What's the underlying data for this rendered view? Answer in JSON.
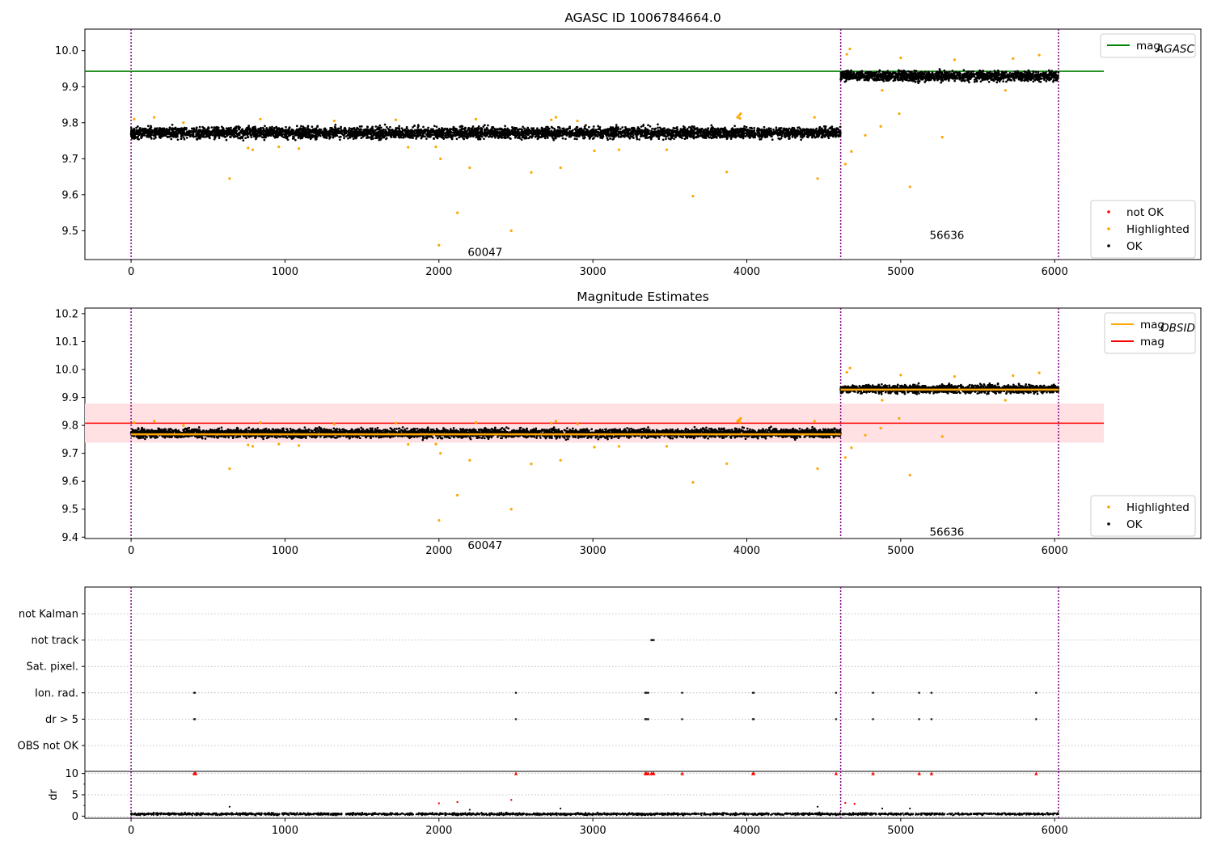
{
  "chart_data": [
    {
      "type": "scatter",
      "title": "AGASC ID 1006784664.0",
      "xlim": [
        -300,
        6950
      ],
      "ylim": [
        9.42,
        10.06
      ],
      "xticks": [
        0,
        1000,
        2000,
        3000,
        4000,
        5000,
        6000
      ],
      "yticks": [
        9.5,
        9.6,
        9.7,
        9.8,
        9.9,
        10.0
      ],
      "obs_boundaries": [
        0,
        4610,
        6025
      ],
      "segments": [
        {
          "label": "60047",
          "x_range": [
            0,
            4610
          ],
          "mean": 9.772,
          "spread": 0.02
        },
        {
          "label": "56636",
          "x_range": [
            4610,
            6025
          ],
          "mean": 9.93,
          "spread": 0.018
        }
      ],
      "hlines": [
        {
          "name": "mag_AGASC",
          "y": 9.943,
          "x_range": [
            -300,
            6320
          ],
          "color": "#008000"
        }
      ],
      "highlighted_points": [
        [
          640,
          9.645
        ],
        [
          760,
          9.73
        ],
        [
          790,
          9.725
        ],
        [
          960,
          9.733
        ],
        [
          1090,
          9.728
        ],
        [
          1800,
          9.732
        ],
        [
          1980,
          9.733
        ],
        [
          2000,
          9.46
        ],
        [
          2010,
          9.7
        ],
        [
          2120,
          9.55
        ],
        [
          2200,
          9.675
        ],
        [
          2470,
          9.5
        ],
        [
          2600,
          9.662
        ],
        [
          2790,
          9.675
        ],
        [
          3010,
          9.722
        ],
        [
          3170,
          9.725
        ],
        [
          3480,
          9.725
        ],
        [
          3650,
          9.596
        ],
        [
          3870,
          9.663
        ],
        [
          4460,
          9.645
        ],
        [
          4640,
          9.685
        ],
        [
          4680,
          9.72
        ],
        [
          4770,
          9.765
        ],
        [
          4870,
          9.79
        ],
        [
          4990,
          9.825
        ],
        [
          4880,
          9.89
        ],
        [
          5060,
          9.622
        ],
        [
          5270,
          9.76
        ],
        [
          5680,
          9.89
        ],
        [
          5730,
          9.978
        ],
        [
          5900,
          9.988
        ],
        [
          20,
          9.81
        ],
        [
          150,
          9.815
        ],
        [
          340,
          9.8
        ],
        [
          840,
          9.81
        ],
        [
          1320,
          9.805
        ],
        [
          1720,
          9.808
        ],
        [
          2240,
          9.81
        ],
        [
          2730,
          9.808
        ],
        [
          2760,
          9.815
        ],
        [
          2900,
          9.805
        ],
        [
          3940,
          9.815
        ],
        [
          3950,
          9.82
        ],
        [
          3955,
          9.812
        ],
        [
          3960,
          9.825
        ],
        [
          4440,
          9.815
        ],
        [
          4650,
          9.99
        ],
        [
          4670,
          10.005
        ],
        [
          5000,
          9.98
        ],
        [
          5350,
          9.975
        ]
      ],
      "annotations": [
        {
          "text": "60047",
          "x": 2300,
          "y": 9.43
        },
        {
          "text": "56636",
          "x": 5300,
          "y": 9.477
        }
      ],
      "legends": [
        {
          "position": "upper-right",
          "entries": [
            {
              "label": "mag",
              "sub": "AGASC",
              "color": "#008000",
              "kind": "line"
            }
          ]
        },
        {
          "position": "lower-right",
          "entries": [
            {
              "label": "not OK",
              "color": "#ff0000",
              "kind": "marker"
            },
            {
              "label": "Highlighted",
              "color": "#ffa500",
              "kind": "marker"
            },
            {
              "label": "OK",
              "color": "#000000",
              "kind": "marker"
            }
          ]
        }
      ]
    },
    {
      "type": "scatter",
      "title": "Magnitude Estimates",
      "xlim": [
        -300,
        6950
      ],
      "ylim": [
        9.395,
        10.22
      ],
      "xticks": [
        0,
        1000,
        2000,
        3000,
        4000,
        5000,
        6000
      ],
      "yticks": [
        9.4,
        9.5,
        9.6,
        9.7,
        9.8,
        9.9,
        10.0,
        10.1,
        10.2
      ],
      "obs_boundaries": [
        0,
        4610,
        6025
      ],
      "segments": [
        {
          "label": "60047",
          "x_range": [
            0,
            4610
          ],
          "mean": 9.772,
          "spread": 0.02
        },
        {
          "label": "56636",
          "x_range": [
            4610,
            6025
          ],
          "mean": 9.93,
          "spread": 0.018
        }
      ],
      "obsid_lines": [
        {
          "x_range": [
            0,
            4610
          ],
          "y": 9.768
        },
        {
          "x_range": [
            4610,
            6025
          ],
          "y": 9.928
        }
      ],
      "hlines": [
        {
          "name": "mag",
          "y": 9.808,
          "x_range": [
            -300,
            6320
          ],
          "color": "#ff0000"
        }
      ],
      "band": {
        "x_range": [
          -300,
          6320
        ],
        "y_range": [
          9.738,
          9.878
        ],
        "color": "#ffe0e3"
      },
      "highlighted_points": [
        [
          640,
          9.645
        ],
        [
          760,
          9.73
        ],
        [
          790,
          9.725
        ],
        [
          960,
          9.733
        ],
        [
          1090,
          9.728
        ],
        [
          1800,
          9.732
        ],
        [
          1980,
          9.733
        ],
        [
          2000,
          9.46
        ],
        [
          2010,
          9.7
        ],
        [
          2120,
          9.55
        ],
        [
          2200,
          9.675
        ],
        [
          2470,
          9.5
        ],
        [
          2600,
          9.662
        ],
        [
          2790,
          9.675
        ],
        [
          3010,
          9.722
        ],
        [
          3170,
          9.725
        ],
        [
          3480,
          9.725
        ],
        [
          3650,
          9.596
        ],
        [
          3870,
          9.663
        ],
        [
          4460,
          9.645
        ],
        [
          4640,
          9.685
        ],
        [
          4680,
          9.72
        ],
        [
          4770,
          9.765
        ],
        [
          4870,
          9.79
        ],
        [
          4990,
          9.825
        ],
        [
          4880,
          9.89
        ],
        [
          5060,
          9.622
        ],
        [
          5270,
          9.76
        ],
        [
          5680,
          9.89
        ],
        [
          5730,
          9.978
        ],
        [
          5900,
          9.988
        ],
        [
          20,
          9.81
        ],
        [
          150,
          9.815
        ],
        [
          340,
          9.8
        ],
        [
          840,
          9.81
        ],
        [
          1320,
          9.805
        ],
        [
          1720,
          9.808
        ],
        [
          2240,
          9.81
        ],
        [
          2730,
          9.808
        ],
        [
          2760,
          9.815
        ],
        [
          2900,
          9.805
        ],
        [
          3940,
          9.815
        ],
        [
          3950,
          9.82
        ],
        [
          3955,
          9.812
        ],
        [
          3960,
          9.825
        ],
        [
          4440,
          9.815
        ],
        [
          4650,
          9.99
        ],
        [
          4670,
          10.005
        ],
        [
          5000,
          9.98
        ],
        [
          5350,
          9.975
        ]
      ],
      "annotations": [
        {
          "text": "60047",
          "x": 2300,
          "y": 9.43
        },
        {
          "text": "56636",
          "x": 5300,
          "y": 9.477
        }
      ],
      "legends": [
        {
          "position": "upper-right",
          "entries": [
            {
              "label": "mag",
              "sub": "OBSID",
              "color": "#ffa500",
              "kind": "line"
            },
            {
              "label": "mag",
              "color": "#ff0000",
              "kind": "line"
            }
          ]
        },
        {
          "position": "lower-right",
          "entries": [
            {
              "label": "Highlighted",
              "color": "#ffa500",
              "kind": "marker"
            },
            {
              "label": "OK",
              "color": "#000000",
              "kind": "marker"
            }
          ]
        }
      ]
    },
    {
      "type": "scatter",
      "xlim": [
        -300,
        6950
      ],
      "flag_rows": [
        "not Kalman",
        "not track",
        "Sat. pixel.",
        "Ion. rad.",
        "dr > 5",
        "OBS not OK"
      ],
      "obs_boundaries": [
        0,
        4610,
        6025
      ],
      "flag_points": {
        "not track": [
          3380,
          3385,
          3390,
          3395
        ],
        "Ion. rad.": [
          410,
          415,
          2500,
          3340,
          3345,
          3350,
          3360,
          3580,
          4040,
          4045,
          4580,
          4820,
          5120,
          5200,
          5880
        ],
        "dr > 5": [
          410,
          415,
          2500,
          3340,
          3345,
          3350,
          3360,
          3580,
          4040,
          4045,
          4580,
          4820,
          5120,
          5200,
          5880
        ]
      }
    },
    {
      "type": "scatter",
      "ylabel": "dr",
      "xlim": [
        -300,
        6950
      ],
      "ylim": [
        -0.5,
        10.5
      ],
      "xticks": [
        0,
        1000,
        2000,
        3000,
        4000,
        5000,
        6000
      ],
      "yticks": [
        0,
        5,
        10
      ],
      "obs_boundaries": [
        0,
        4610,
        6025
      ],
      "ok_points_range": [
        0,
        6025
      ],
      "ok_points_level": 0.5,
      "ok_points_spread": 0.3,
      "red_clipped_points": [
        410,
        415,
        420,
        2500,
        3340,
        3345,
        3350,
        3360,
        3380,
        3390,
        3395,
        3580,
        4040,
        4045,
        4580,
        4820,
        5120,
        5200,
        5880
      ],
      "red_points": [
        [
          2000,
          3.0
        ],
        [
          2120,
          3.3
        ],
        [
          2470,
          3.8
        ],
        [
          4640,
          3.1
        ],
        [
          4700,
          2.9
        ]
      ],
      "black_outliers": [
        [
          640,
          2.2
        ],
        [
          2200,
          1.5
        ],
        [
          2790,
          1.8
        ],
        [
          4460,
          2.2
        ],
        [
          4880,
          1.8
        ],
        [
          5060,
          1.8
        ]
      ]
    }
  ]
}
